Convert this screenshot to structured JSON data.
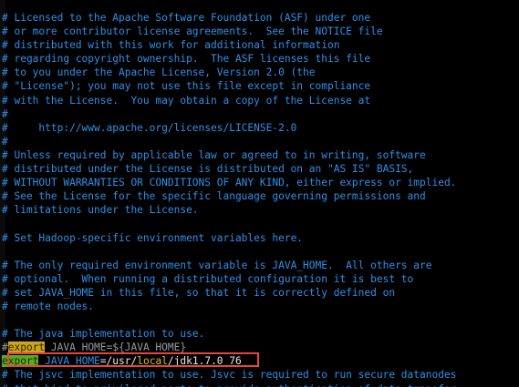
{
  "editor": {
    "comment_lines": [
      "# Licensed to the Apache Software Foundation (ASF) under one",
      "# or more contributor license agreements.  See the NOTICE file",
      "# distributed with this work for additional information",
      "# regarding copyright ownership.  The ASF licenses this file",
      "# to you under the Apache License, Version 2.0 (the",
      "# \"License\"); you may not use this file except in compliance",
      "# with the License.  You may obtain a copy of the License at",
      "#",
      "#     http://www.apache.org/licenses/LICENSE-2.0",
      "#",
      "# Unless required by applicable law or agreed to in writing, software",
      "# distributed under the License is distributed on an \"AS IS\" BASIS,",
      "# WITHOUT WARRANTIES OR CONDITIONS OF ANY KIND, either express or implied.",
      "# See the License for the specific language governing permissions and",
      "# limitations under the License.",
      "",
      "# Set Hadoop-specific environment variables here.",
      "",
      "# The only required environment variable is JAVA_HOME.  All others are",
      "# optional.  When running a distributed configuration it is best to",
      "# set JAVA_HOME in this file, so that it is correctly defined on",
      "# remote nodes.",
      "",
      "# The java implementation to use."
    ],
    "commented_export": {
      "hash": "#",
      "keyword": "export",
      "rest": " JAVA_HOME=${JAVA_HOME}"
    },
    "active_export": {
      "keyword": "export",
      "space": " ",
      "var": "JAVA_HOME",
      "eq": "=",
      "path_a": "/usr/",
      "path_b": "local",
      "path_c": "/jdk1.7.0_76"
    },
    "trailing_lines": [
      "# The jsvc implementation to use. Jsvc is required to run secure datanodes",
      "# that bind to privileged ports to provide authentication of data transfer"
    ]
  },
  "colors": {
    "background": "#000000",
    "comment": "#2f8fe6",
    "export_keyword_bg": "#c9a61d",
    "export_keyword_active_bg": "#5fa81f",
    "highlight_border": "#e8453c",
    "path_yellow": "#d8c21a"
  }
}
